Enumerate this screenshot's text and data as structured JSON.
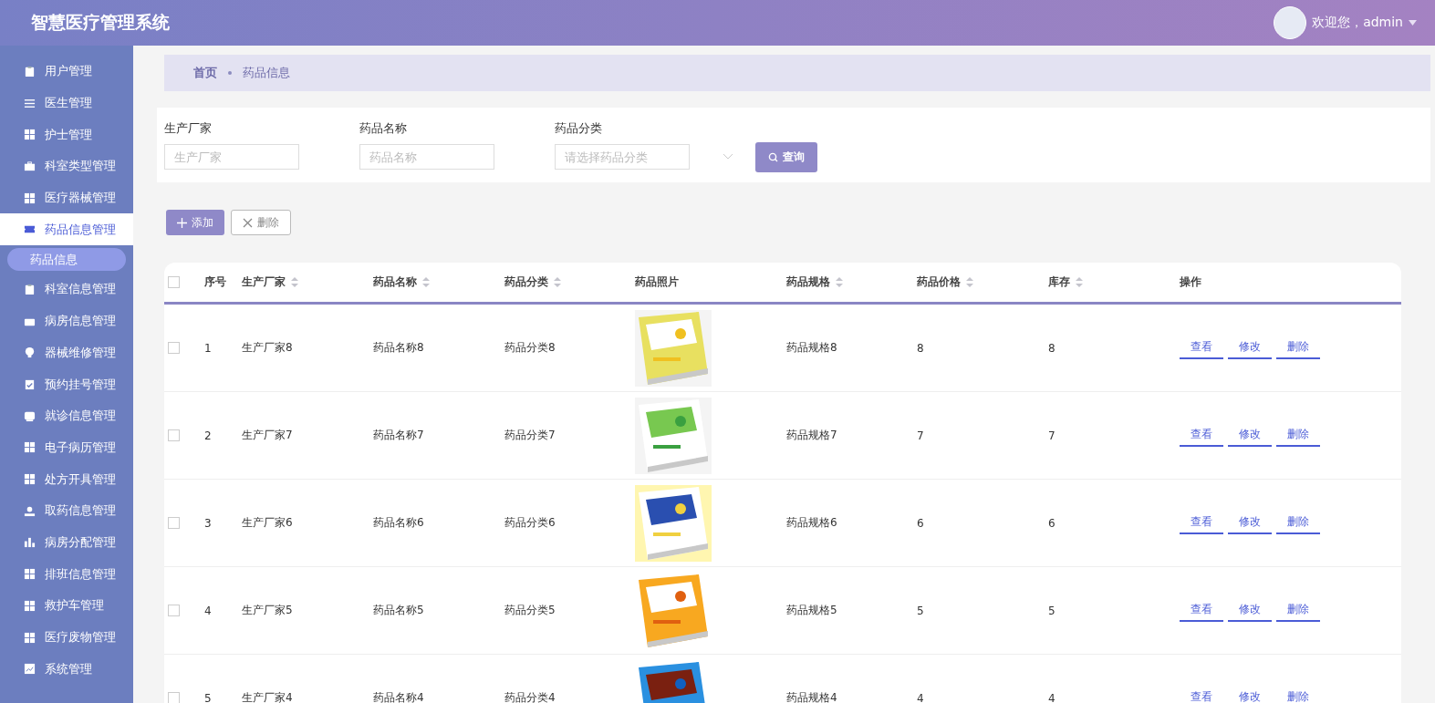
{
  "header": {
    "title": "智慧医疗管理系统",
    "user": "欢迎您，admin"
  },
  "sidebar": {
    "items": [
      {
        "label": "用户管理",
        "selected": false
      },
      {
        "label": "医生管理",
        "selected": false
      },
      {
        "label": "护士管理",
        "selected": false
      },
      {
        "label": "科室类型管理",
        "selected": false
      },
      {
        "label": "医疗器械管理",
        "selected": false
      },
      {
        "label": "药品信息管理",
        "selected": true,
        "children": [
          {
            "label": "药品信息",
            "selected": true
          }
        ]
      },
      {
        "label": "科室信息管理",
        "selected": false
      },
      {
        "label": "病房信息管理",
        "selected": false
      },
      {
        "label": "器械维修管理",
        "selected": false
      },
      {
        "label": "预约挂号管理",
        "selected": false
      },
      {
        "label": "就诊信息管理",
        "selected": false
      },
      {
        "label": "电子病历管理",
        "selected": false
      },
      {
        "label": "处方开具管理",
        "selected": false
      },
      {
        "label": "取药信息管理",
        "selected": false
      },
      {
        "label": "病房分配管理",
        "selected": false
      },
      {
        "label": "排班信息管理",
        "selected": false
      },
      {
        "label": "救护车管理",
        "selected": false
      },
      {
        "label": "医疗废物管理",
        "selected": false
      },
      {
        "label": "系统管理",
        "selected": false
      }
    ]
  },
  "breadcrumb": [
    "首页",
    "药品信息"
  ],
  "filters": [
    {
      "label": "生产厂家",
      "placeholder": "生产厂家",
      "kind": "text"
    },
    {
      "label": "药品名称",
      "placeholder": "药品名称",
      "kind": "text"
    },
    {
      "label": "药品分类",
      "placeholder": "请选择药品分类",
      "kind": "select"
    }
  ],
  "search_button": "查询",
  "actions": [
    {
      "label": "添加",
      "kind": "primary"
    },
    {
      "label": "删除",
      "kind": "outline"
    }
  ],
  "table": {
    "columns": [
      {
        "label": "序号",
        "sortable": false
      },
      {
        "label": "生产厂家",
        "sortable": true
      },
      {
        "label": "药品名称",
        "sortable": true
      },
      {
        "label": "药品分类",
        "sortable": true
      },
      {
        "label": "药品照片",
        "sortable": false
      },
      {
        "label": "药品规格",
        "sortable": true
      },
      {
        "label": "药品价格",
        "sortable": true
      },
      {
        "label": "库存",
        "sortable": true
      },
      {
        "label": "操作",
        "sortable": false
      }
    ],
    "all_checked": false,
    "rows": [
      {
        "checked": false,
        "cells": [
          "1",
          "生产厂家8",
          "药品名称8",
          "药品分类8",
          {
            "kind": "picture"
          },
          "药品规格8",
          "8",
          "8"
        ],
        "actions": [
          "查看",
          "修改",
          "删除"
        ]
      },
      {
        "checked": false,
        "cells": [
          "2",
          "生产厂家7",
          "药品名称7",
          "药品分类7",
          {
            "kind": "picture"
          },
          "药品规格7",
          "7",
          "7"
        ],
        "actions": [
          "查看",
          "修改",
          "删除"
        ]
      },
      {
        "checked": false,
        "cells": [
          "3",
          "生产厂家6",
          "药品名称6",
          "药品分类6",
          {
            "kind": "picture"
          },
          "药品规格6",
          "6",
          "6"
        ],
        "actions": [
          "查看",
          "修改",
          "删除"
        ]
      },
      {
        "checked": false,
        "cells": [
          "4",
          "生产厂家5",
          "药品名称5",
          "药品分类5",
          {
            "kind": "picture"
          },
          "药品规格5",
          "5",
          "5"
        ],
        "actions": [
          "查看",
          "修改",
          "删除"
        ]
      },
      {
        "checked": false,
        "cells": [
          "5",
          "生产厂家4",
          "药品名称4",
          "药品分类4",
          {
            "kind": "picture"
          },
          "药品规格4",
          "4",
          "4"
        ],
        "actions": [
          "查看",
          "修改",
          "删除"
        ]
      }
    ]
  }
}
